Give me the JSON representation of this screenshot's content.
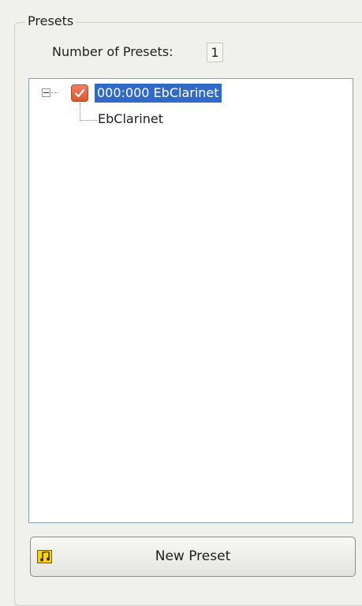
{
  "presets_group": {
    "title": "Presets",
    "count_label": "Number of Presets:",
    "count_value": "1"
  },
  "tree": {
    "items": [
      {
        "label": "000:000 EbClarinet",
        "selected": true,
        "expanded": true,
        "icon": "checkbox-icon",
        "children": [
          {
            "label": "EbClarinet"
          }
        ]
      }
    ]
  },
  "new_preset_button": {
    "label": "New Preset",
    "icon": "music-note-icon"
  },
  "colors": {
    "selection": "#3169c6",
    "check_icon": "#e06640",
    "button_icon": "#ffd400"
  }
}
